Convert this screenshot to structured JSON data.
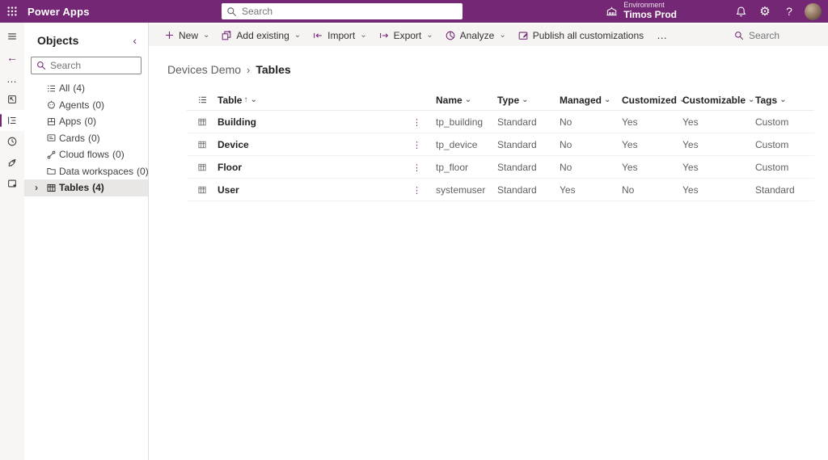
{
  "colors": {
    "brand": "#742774",
    "topbar_bg": "#742774",
    "commandbar_bg": "#f5f4f3",
    "selected_nav_bg": "#e9e7e5",
    "text_primary": "#242424",
    "text_secondary": "#616161"
  },
  "icons": {
    "chevron_down": "⌄",
    "sort_asc": "↑",
    "more": "…",
    "vert_ellipsis": "⋮",
    "back": "←",
    "collapse": "‹",
    "expand": "›",
    "breadcrumb_sep": "›",
    "gear": "⚙︎"
  },
  "topbar": {
    "app_title": "Power Apps",
    "search_placeholder": "Search",
    "environment_label": "Environment",
    "environment_name": "Timos Prod",
    "help_label": "?"
  },
  "sidebar": {
    "title": "Objects",
    "search_placeholder": "Search",
    "items": [
      {
        "label": "All",
        "count": "(4)"
      },
      {
        "label": "Agents",
        "count": "(0)"
      },
      {
        "label": "Apps",
        "count": "(0)"
      },
      {
        "label": "Cards",
        "count": "(0)"
      },
      {
        "label": "Cloud flows",
        "count": "(0)"
      },
      {
        "label": "Data workspaces",
        "count": "(0)"
      },
      {
        "label": "Tables",
        "count": "(4)"
      }
    ]
  },
  "commandbar": {
    "items": [
      {
        "label": "New"
      },
      {
        "label": "Add existing"
      },
      {
        "label": "Import"
      },
      {
        "label": "Export"
      },
      {
        "label": "Analyze"
      },
      {
        "label": "Publish all customizations"
      }
    ],
    "search_placeholder": "Search"
  },
  "breadcrumb": {
    "parent": "Devices Demo",
    "current": "Tables"
  },
  "grid": {
    "headers": {
      "table": "Table",
      "name": "Name",
      "type": "Type",
      "managed": "Managed",
      "customized": "Customized",
      "customizable": "Customizable",
      "tags": "Tags"
    },
    "rows": [
      {
        "table": "Building",
        "name": "tp_building",
        "type": "Standard",
        "managed": "No",
        "customized": "Yes",
        "customizable": "Yes",
        "tags": "Custom"
      },
      {
        "table": "Device",
        "name": "tp_device",
        "type": "Standard",
        "managed": "No",
        "customized": "Yes",
        "customizable": "Yes",
        "tags": "Custom"
      },
      {
        "table": "Floor",
        "name": "tp_floor",
        "type": "Standard",
        "managed": "No",
        "customized": "Yes",
        "customizable": "Yes",
        "tags": "Custom"
      },
      {
        "table": "User",
        "name": "systemuser",
        "type": "Standard",
        "managed": "Yes",
        "customized": "No",
        "customizable": "Yes",
        "tags": "Standard"
      }
    ]
  }
}
